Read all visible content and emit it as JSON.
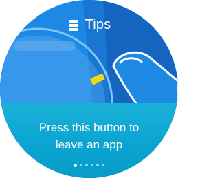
{
  "header": {
    "title": "Tips",
    "icon": "watch-tips-icon"
  },
  "tip": {
    "message_line1": "Press this button to",
    "message_line2": "leave an app"
  },
  "pagination": {
    "total": 6,
    "active_index": 0
  },
  "colors": {
    "background_blue": "#1976d2",
    "band_cyan": "#0aa3d1",
    "highlight_yellow": "#f2d41e"
  }
}
